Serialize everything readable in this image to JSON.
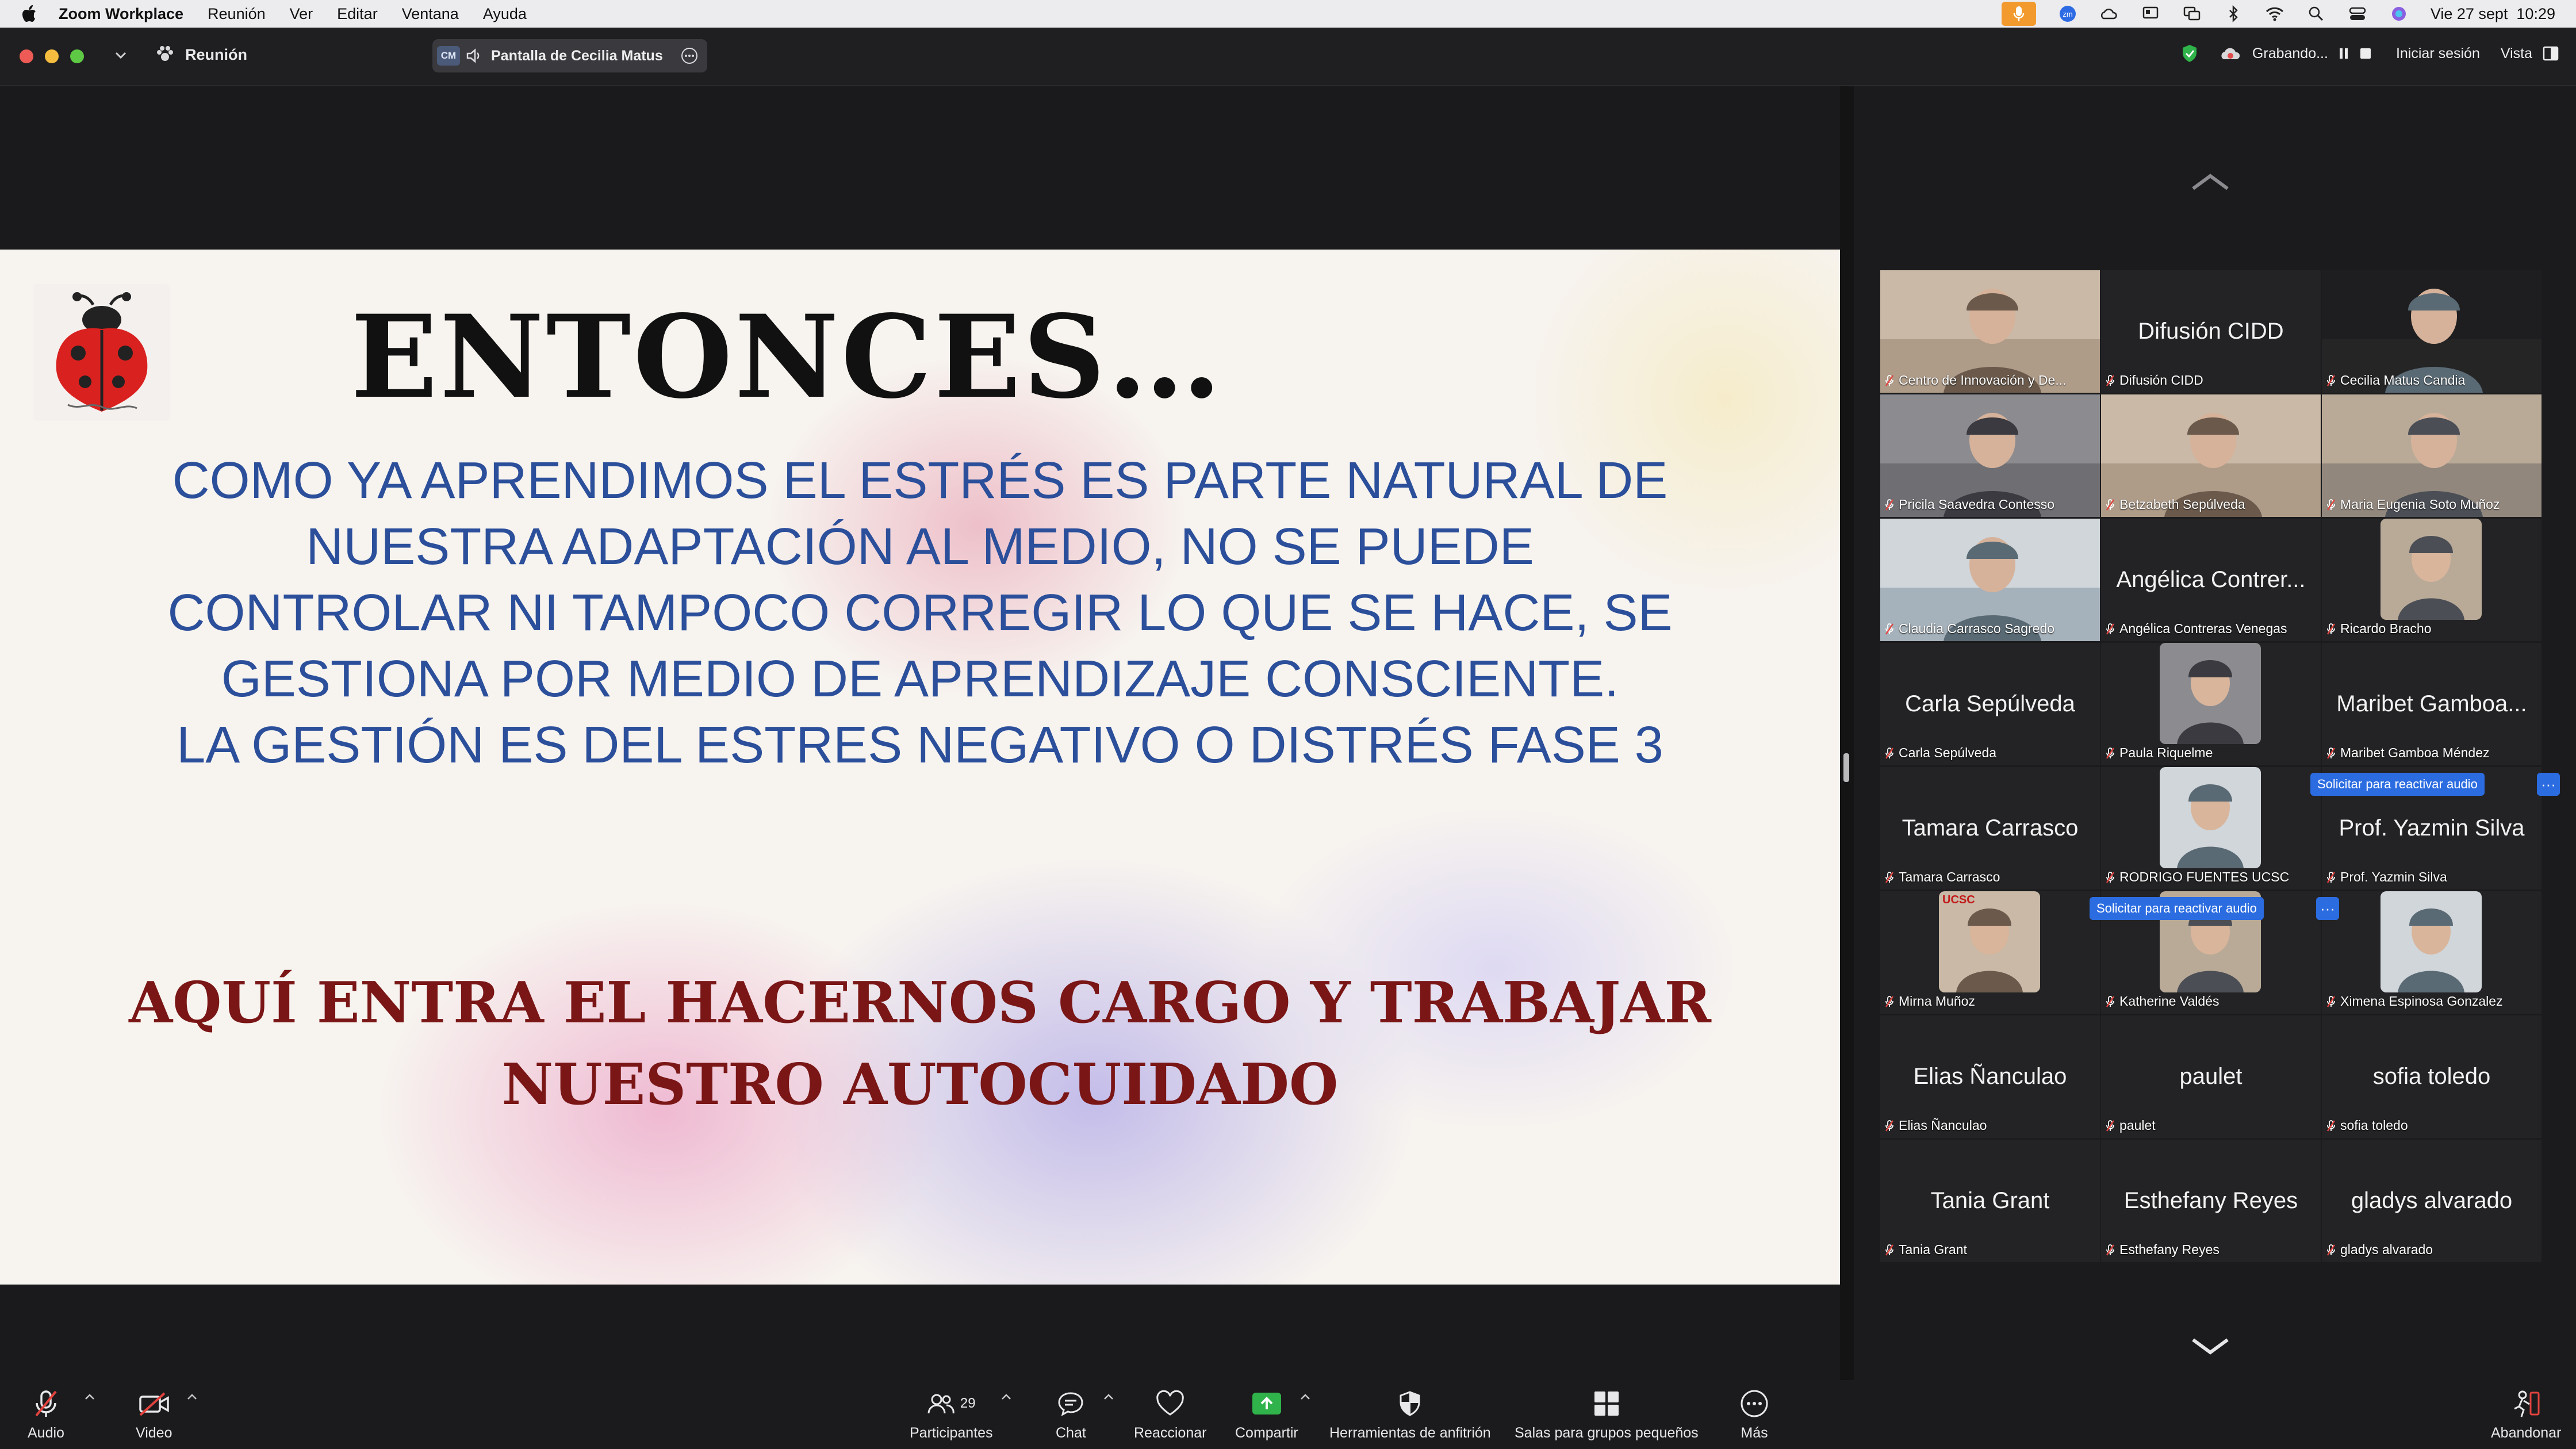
{
  "menubar": {
    "app_name": "Zoom Workplace",
    "items": [
      "Reunión",
      "Ver",
      "Editar",
      "Ventana",
      "Ayuda"
    ],
    "datetime": "Vie 27 sept  10:29"
  },
  "titlebar": {
    "meeting_label": "Reunión",
    "share_initials": "CM",
    "share_label": "Pantalla de Cecilia Matus",
    "recording_label": "Grabando...",
    "signin_label": "Iniciar sesión",
    "view_label": "Vista"
  },
  "slide": {
    "heading": "ENTONCES…",
    "body_lines": [
      "COMO YA APRENDIMOS EL ESTRÉS ES PARTE NATURAL DE",
      "NUESTRA ADAPTACIÓN AL MEDIO, NO SE PUEDE",
      "CONTROLAR NI TAMPOCO CORREGIR LO QUE SE HACE,  SE",
      "GESTIONA POR MEDIO DE APRENDIZAJE CONSCIENTE.",
      "LA GESTIÓN ES DEL ESTRES NEGATIVO O DISTRÉS FASE 3"
    ],
    "highlight_lines": [
      "AQUÍ ENTRA EL HACERNOS CARGO Y TRABAJAR",
      "NUESTRO AUTOCUIDADO"
    ]
  },
  "gallery": {
    "participants": [
      {
        "caption": "Centro de Innovación y De...",
        "big_name": "",
        "video": "photo-room"
      },
      {
        "caption": "Difusión CIDD",
        "big_name": "Difusión CIDD",
        "video": "none"
      },
      {
        "caption": "Cecilia Matus Candia",
        "big_name": "",
        "video": "photo-dark",
        "active": true
      },
      {
        "caption": "Pricila Saavedra Contesso",
        "big_name": "",
        "video": "photo-room"
      },
      {
        "caption": "Betzabeth Sepúlveda",
        "big_name": "",
        "video": "photo-room"
      },
      {
        "caption": "Maria  Eugenia Soto Muñoz",
        "big_name": "",
        "video": "photo-room"
      },
      {
        "caption": "Claudia Carrasco Sagredo",
        "big_name": "",
        "video": "photo-room"
      },
      {
        "caption": "Angélica Contreras Venegas",
        "big_name": "Angélica Contrer...",
        "video": "none"
      },
      {
        "caption": "Ricardo Bracho",
        "big_name": "",
        "video": "avatar"
      },
      {
        "caption": "Carla Sepúlveda",
        "big_name": "Carla Sepúlveda",
        "video": "none"
      },
      {
        "caption": "Paula Riquelme",
        "big_name": "",
        "video": "avatar"
      },
      {
        "caption": "Maribet Gamboa Méndez",
        "big_name": "Maribet Gamboa...",
        "video": "none"
      },
      {
        "caption": "Tamara Carrasco",
        "big_name": "Tamara Carrasco",
        "video": "none"
      },
      {
        "caption": "RODRIGO FUENTES UCSC",
        "big_name": "",
        "video": "avatar"
      },
      {
        "caption": "Prof. Yazmin Silva",
        "big_name": "Prof. Yazmin Silva",
        "video": "none"
      },
      {
        "caption": "Mirna Muñoz",
        "big_name": "",
        "video": "avatar"
      },
      {
        "caption": "Katherine Valdés",
        "big_name": "",
        "video": "avatar"
      },
      {
        "caption": "Ximena Espinosa Gonzalez",
        "big_name": "",
        "video": "avatar"
      },
      {
        "caption": "Elias Ñanculao",
        "big_name": "Elias Ñanculao",
        "video": "none"
      },
      {
        "caption": "paulet",
        "big_name": "paulet",
        "video": "none"
      },
      {
        "caption": "sofia toledo",
        "big_name": "sofia toledo",
        "video": "none"
      },
      {
        "caption": "Tania Grant",
        "big_name": "Tania Grant",
        "video": "none"
      },
      {
        "caption": "Esthefany Reyes",
        "big_name": "Esthefany Reyes",
        "video": "none"
      },
      {
        "caption": "gladys alvarado",
        "big_name": "gladys alvarado",
        "video": "none"
      }
    ],
    "unmute_request_label": "Solicitar para reactivar audio",
    "more_label": "···",
    "avatar_badge": "UCSC"
  },
  "toolbar": {
    "audio_label": "Audio",
    "video_label": "Video",
    "participants_label": "Participantes",
    "participants_count": "29",
    "chat_label": "Chat",
    "react_label": "Reaccionar",
    "share_label": "Compartir",
    "host_tools_label": "Herramientas de anfitrión",
    "breakout_label": "Salas para grupos pequeños",
    "more_label": "Más",
    "leave_label": "Abandonar"
  },
  "colors": {
    "accent_green": "#3bc24d",
    "share_green": "#2fb34a",
    "request_blue": "#2b6ce0",
    "mic_orange": "#f29a2e",
    "slide_blue_text": "#2b4f9a",
    "slide_red_text": "#7a1616"
  }
}
